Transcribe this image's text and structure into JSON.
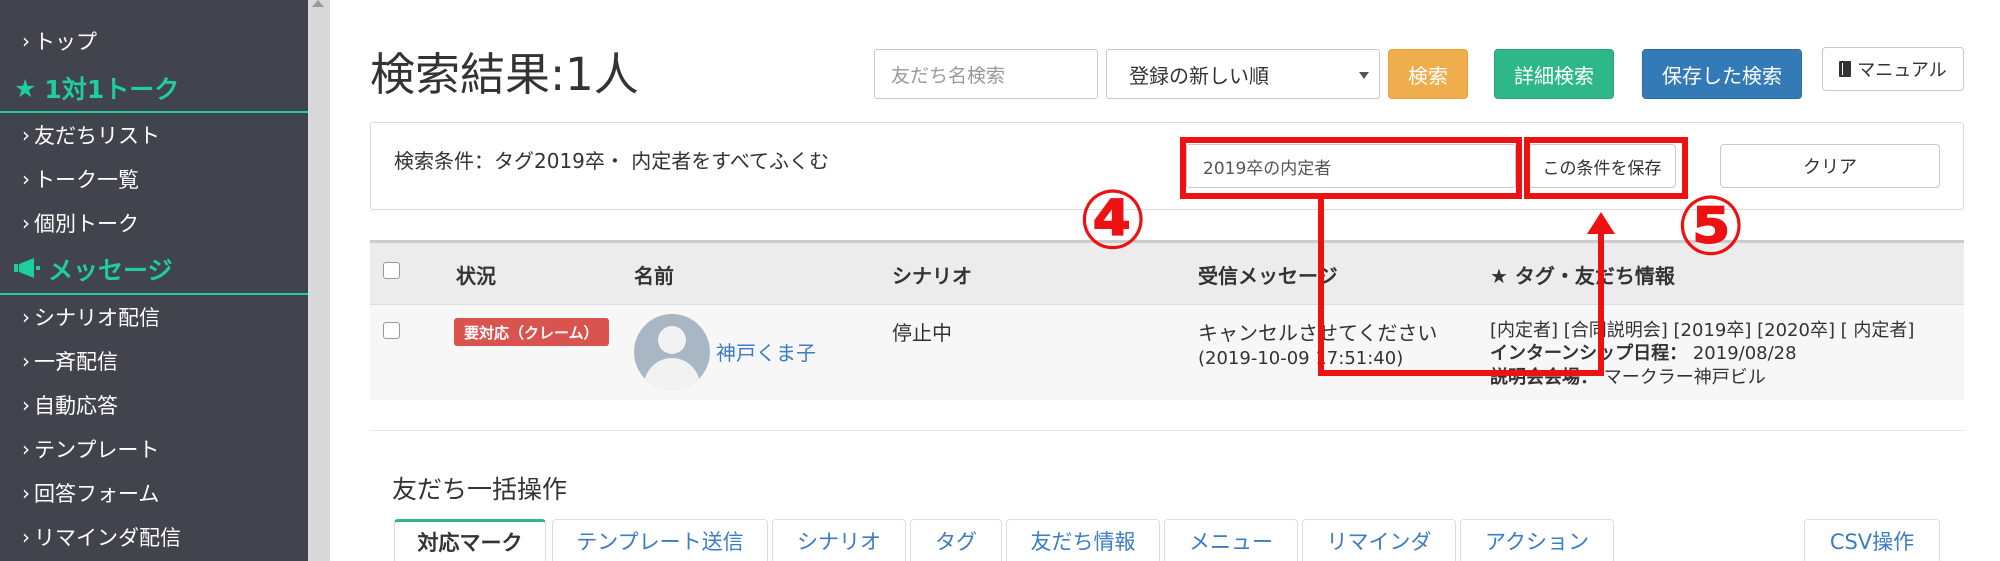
{
  "sidebar": {
    "items": [
      {
        "label": "トップ"
      },
      {
        "label": "1対1トーク",
        "section": true,
        "icon": "star-icon"
      },
      {
        "label": "友だちリスト"
      },
      {
        "label": "トーク一覧"
      },
      {
        "label": "個別トーク"
      },
      {
        "label": "メッセージ",
        "section": true,
        "icon": "megaphone-icon"
      },
      {
        "label": "シナリオ配信"
      },
      {
        "label": "一斉配信"
      },
      {
        "label": "自動応答"
      },
      {
        "label": "テンプレート"
      },
      {
        "label": "回答フォーム"
      },
      {
        "label": "リマインダ配信"
      }
    ],
    "accent_color": "#1fcf9b"
  },
  "header": {
    "title": "検索結果:1人",
    "search_placeholder": "友だち名検索",
    "sort_selected": "登録の新しい順",
    "search_button": "検索",
    "advanced_search_button": "詳細検索",
    "saved_search_button": "保存した検索",
    "manual_button": "マニュアル"
  },
  "condition": {
    "text": "検索条件：タグ2019卒・ 内定者をすべてふくむ",
    "name_input_value": "2019卒の内定者",
    "save_button": "この条件を保存",
    "clear_button": "クリア"
  },
  "table": {
    "columns": [
      "状況",
      "名前",
      "シナリオ",
      "受信メッセージ",
      "★ タグ・友だち情報"
    ],
    "rows": [
      {
        "status": "要対応（クレーム）",
        "name": "神戸くま子",
        "scenario": "停止中",
        "message": "キャンセルさせてください",
        "message_time": "(2019-10-09 17:51:40)",
        "tags": "[内定者] [合同説明会] [2019卒] [2020卒] [ 内定者]",
        "info1_label": "インターンシップ日程：",
        "info1_value": " 2019/08/28",
        "info2_label": "説明会会場：",
        "info2_value": " マークラー神戸ビル"
      }
    ]
  },
  "bulk": {
    "title": "友だち一括操作",
    "tabs": [
      "対応マーク",
      "テンプレート送信",
      "シナリオ",
      "タグ",
      "友だち情報",
      "メニュー",
      "リマインダ",
      "アクション"
    ],
    "csv_button": "CSV操作"
  },
  "annotations": {
    "step4": "④",
    "step5": "⑤",
    "color": "#ee1111"
  }
}
